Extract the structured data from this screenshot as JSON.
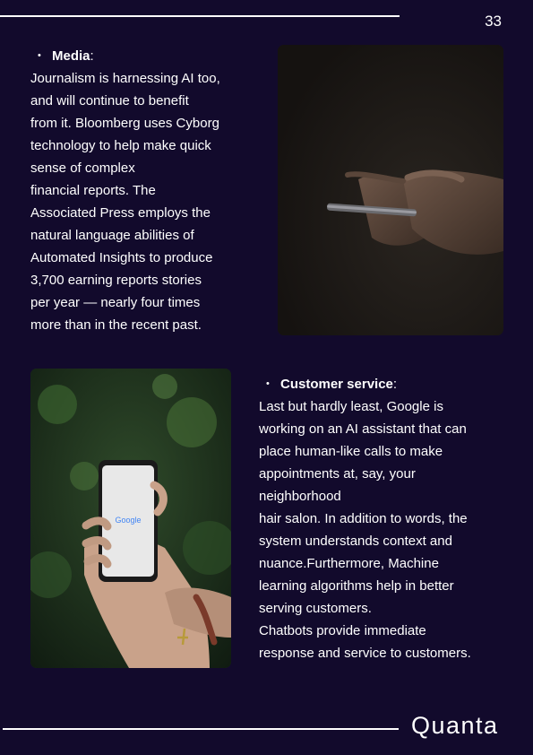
{
  "header": {
    "page_number": "33"
  },
  "media": {
    "heading": "Media",
    "colon": ":",
    "lines": [
      "Journalism is harnessing AI too,",
      "and will continue to benefit",
      "from it. Bloomberg uses Cyborg",
      "technology to help make quick",
      "sense of complex",
      "financial reports. The",
      "Associated Press employs the",
      "natural language abilities of",
      "Automated Insights to produce",
      "3,700 earning reports stories",
      "per year — nearly four times",
      "more than in the recent past."
    ]
  },
  "customer_service": {
    "heading": "Customer service",
    "colon": ":",
    "lines": [
      "Last but hardly least, Google is",
      "working on an AI assistant that can",
      "place human-like calls to make",
      "appointments at, say, your",
      "neighborhood",
      "hair salon. In addition to words, the",
      "system understands context and",
      "nuance.Furthermore, Machine",
      "learning algorithms help in better",
      "serving customers.",
      "Chatbots provide immediate",
      "response and service to customers."
    ]
  },
  "photo_google": {
    "screen_logo": "Google"
  },
  "footer": {
    "brand": "Quanta"
  },
  "colors": {
    "background": "#120a2c",
    "text": "#ffffff"
  },
  "icons": {
    "bullet": "bullet-dot"
  }
}
